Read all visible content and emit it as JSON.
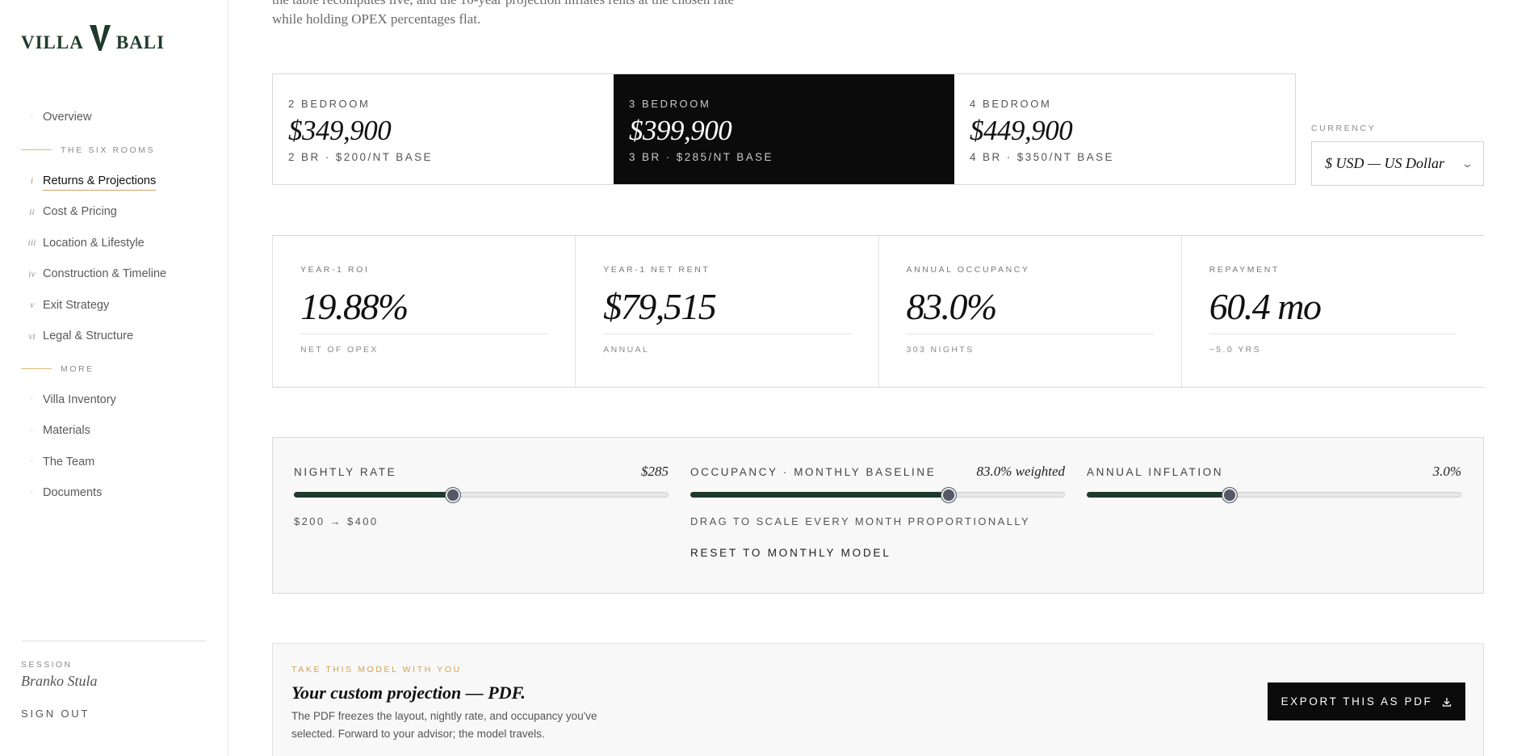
{
  "brand": {
    "word_left": "VILLA",
    "word_right": "BALI"
  },
  "sidebar": {
    "top_items": [
      {
        "marker": "·",
        "label": "Overview"
      }
    ],
    "section_rooms": "THE SIX ROOMS",
    "rooms": [
      {
        "marker": "i",
        "label": "Returns & Projections",
        "active": true
      },
      {
        "marker": "ii",
        "label": "Cost & Pricing"
      },
      {
        "marker": "iii",
        "label": "Location & Lifestyle"
      },
      {
        "marker": "iv",
        "label": "Construction & Timeline"
      },
      {
        "marker": "v",
        "label": "Exit Strategy"
      },
      {
        "marker": "vi",
        "label": "Legal & Structure"
      }
    ],
    "section_more": "MORE",
    "more": [
      {
        "marker": "·",
        "label": "Villa Inventory"
      },
      {
        "marker": "·",
        "label": "Materials"
      },
      {
        "marker": "·",
        "label": "The Team"
      },
      {
        "marker": "·",
        "label": "Documents"
      }
    ],
    "session_label": "SESSION",
    "session_name": "Branko Stula",
    "sign_out": "SIGN OUT"
  },
  "intro": {
    "line1": "the table recomputes live, and the 10-year projection inflates rents at the chosen rate",
    "line2": "while holding OPEX percentages flat."
  },
  "variants": [
    {
      "label": "2 BEDROOM",
      "price": "$349,900",
      "sub": "2 BR · $200/NT BASE",
      "selected": false
    },
    {
      "label": "3 BEDROOM",
      "price": "$399,900",
      "sub": "3 BR · $285/NT BASE",
      "selected": true
    },
    {
      "label": "4 BEDROOM",
      "price": "$449,900",
      "sub": "4 BR · $350/NT BASE",
      "selected": false
    }
  ],
  "currency": {
    "label": "CURRENCY",
    "value": "$ USD — US Dollar"
  },
  "kpis": [
    {
      "label": "YEAR-1 ROI",
      "value": "19.88%",
      "sub": "NET OF OPEX"
    },
    {
      "label": "YEAR-1 NET RENT",
      "value": "$79,515",
      "sub": "ANNUAL"
    },
    {
      "label": "ANNUAL OCCUPANCY",
      "value": "83.0%",
      "sub": "303 NIGHTS"
    },
    {
      "label": "REPAYMENT",
      "value": "60.4 mo",
      "sub": "~5.0 YRS"
    }
  ],
  "controls": {
    "nightly": {
      "label": "NIGHTLY RATE",
      "value": "$285",
      "note": "$200 → $400",
      "level": 0.425
    },
    "occupancy": {
      "label": "OCCUPANCY · MONTHLY BASELINE",
      "value": "83.0% weighted",
      "note": "DRAG TO SCALE EVERY MONTH PROPORTIONALLY",
      "reset": "RESET TO MONTHLY MODEL",
      "level": 0.69
    },
    "inflation": {
      "label": "ANNUAL INFLATION",
      "value": "3.0%",
      "level": 0.38
    }
  },
  "export": {
    "kicker": "TAKE THIS MODEL WITH YOU",
    "title": "Your custom projection — PDF.",
    "desc": "The PDF freezes the layout, nightly rate, and occupancy you've selected. Forward to your advisor; the model travels.",
    "button": "EXPORT THIS AS PDF"
  },
  "icons": {
    "download": "download-icon",
    "chevron": "chevron-down-icon"
  },
  "colors": {
    "brand_green": "#1f3a2b",
    "accent_gold": "#c9a56b",
    "slider_fill": "#1e3a2d",
    "selected_bg": "#0b0b0b"
  }
}
